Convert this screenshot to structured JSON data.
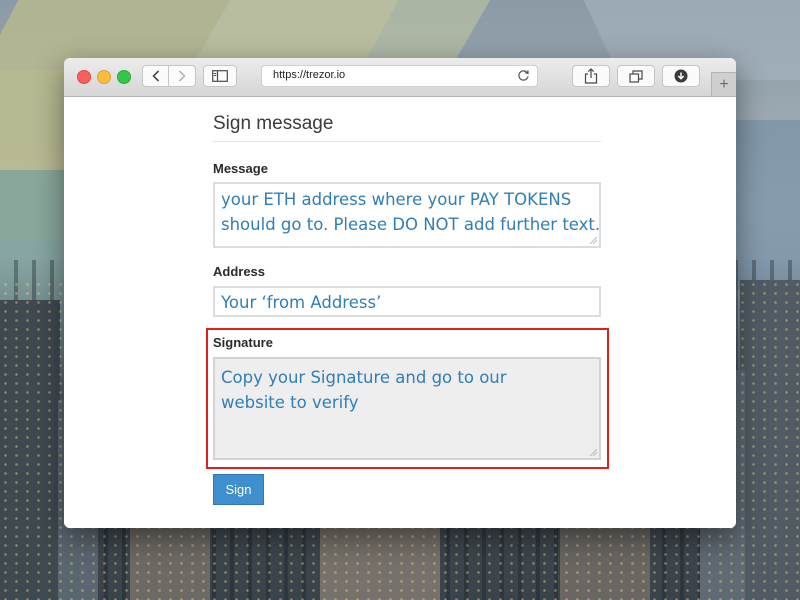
{
  "browser": {
    "url": "https://trezor.io",
    "new_tab_label": "+"
  },
  "form": {
    "title": "Sign message",
    "message": {
      "label": "Message",
      "lines": [
        "your ETH address where your PAY TOKENS",
        "should go to. Please DO NOT add further text."
      ]
    },
    "address": {
      "label": "Address",
      "value": "Your ‘from Address’"
    },
    "signature": {
      "label": "Signature",
      "lines": [
        "Copy your Signature and go to our",
        "website to verify"
      ]
    },
    "sign_button": "Sign"
  },
  "colors": {
    "field_text": "#2f7fb6",
    "highlight_border": "#e21f1f",
    "button_bg": "#3f8fce"
  }
}
